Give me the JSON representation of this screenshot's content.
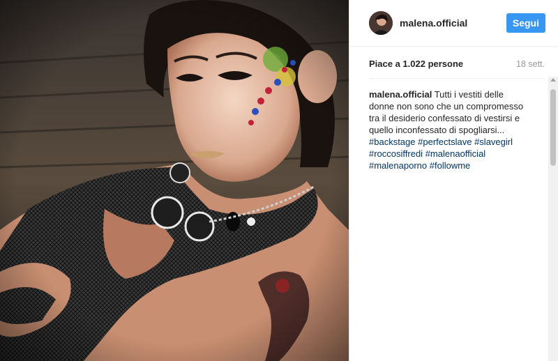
{
  "post": {
    "username": "malena.official",
    "follow_label": "Segui",
    "likes_text": "Piace a 1.022 persone",
    "time_text": "18 sett.",
    "caption": {
      "username": "malena.official",
      "text": "Tutti i vestiti delle donne non sono che un compromesso tra il desiderio confessato di vestirsi e quello inconfessato di spogliarsi...",
      "hashtags": [
        "#backstage",
        "#perfectslave",
        "#slavegirl",
        "#roccosiffredi",
        "#malenaofficial",
        "#malenaporno",
        "#followme"
      ]
    }
  }
}
